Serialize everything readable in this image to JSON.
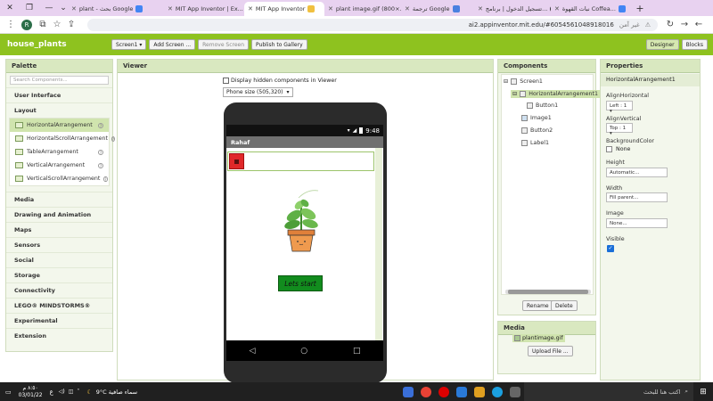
{
  "browser": {
    "tabs": [
      {
        "label": "plant - بحث Google",
        "active": false
      },
      {
        "label": "MIT App Inventor | Ex...",
        "active": false
      },
      {
        "label": "MIT App Inventor",
        "active": true
      },
      {
        "label": "plant image.gif (800×...",
        "active": false
      },
      {
        "label": "ترجمة Google",
        "active": false
      },
      {
        "label": "تسجيل الدخول | برنامج...",
        "active": false
      },
      {
        "label": "نبات القهوة Coffea...",
        "active": false
      }
    ],
    "new_tab": "+",
    "url": "ai2.appinventor.mit.edu/#6054561048918016",
    "insecure_label": "غير آمن",
    "avatar_letter": "R"
  },
  "app": {
    "project_name": "house_plants",
    "buttons": {
      "screen": "Screen1 ▾",
      "add_screen": "Add Screen ...",
      "remove_screen": "Remove Screen",
      "publish": "Publish to Gallery",
      "designer": "Designer",
      "blocks": "Blocks"
    }
  },
  "palette": {
    "title": "Palette",
    "search_placeholder": "Search Components...",
    "categories_top": [
      "User Interface",
      "Layout"
    ],
    "layout_items": [
      {
        "label": "HorizontalArrangement",
        "selected": true
      },
      {
        "label": "HorizontalScrollArrangement",
        "selected": false
      },
      {
        "label": "TableArrangement",
        "selected": false
      },
      {
        "label": "VerticalArrangement",
        "selected": false
      },
      {
        "label": "VerticalScrollArrangement",
        "selected": false
      }
    ],
    "categories_bottom": [
      "Media",
      "Drawing and Animation",
      "Maps",
      "Sensors",
      "Social",
      "Storage",
      "Connectivity",
      "LEGO® MINDSTORMS®",
      "Experimental",
      "Extension"
    ],
    "help_glyph": "?"
  },
  "viewer": {
    "title": "Viewer",
    "hidden_checkbox_label": "Display hidden components in Viewer",
    "phone_size": "Phone size (505,320)",
    "time": "9:48",
    "screen_title": "Rahaf",
    "button_label": "Lets start",
    "nav_icons": [
      "◁",
      "○",
      "□"
    ]
  },
  "components": {
    "title": "Components",
    "tree": [
      {
        "label": "Screen1",
        "toggle": "⊟"
      },
      {
        "label": "HorizontalArrangement1",
        "toggle": "⊟"
      },
      {
        "label": "Button1",
        "toggle": ""
      },
      {
        "label": "Image1",
        "toggle": ""
      },
      {
        "label": "Button2",
        "toggle": ""
      },
      {
        "label": "Label1",
        "toggle": ""
      }
    ],
    "rename": "Rename",
    "delete": "Delete"
  },
  "properties": {
    "title": "Properties",
    "component": "HorizontalArrangement1",
    "align_h_label": "AlignHorizontal",
    "align_h_value": "Left : 1 ▾",
    "align_v_label": "AlignVertical",
    "align_v_value": "Top : 1 ▾",
    "bg_label": "BackgroundColor",
    "bg_value": "None",
    "height_label": "Height",
    "height_value": "Automatic...",
    "width_label": "Width",
    "width_value": "Fill parent...",
    "image_label": "Image",
    "image_value": "None...",
    "visible_label": "Visible"
  },
  "media": {
    "title": "Media",
    "file": "plantimage.gif",
    "upload": "Upload File ..."
  },
  "taskbar": {
    "search_placeholder": "اكتب هنا للبحث",
    "weather": "9°C سماء صافية",
    "lang": "ع",
    "time": "٨:٥٠ م",
    "date": "03/01/22"
  },
  "colors": {
    "brand_green": "#8ec21f",
    "viewer_button": "#128c1e",
    "arrangement_border": "#9cc46a"
  }
}
